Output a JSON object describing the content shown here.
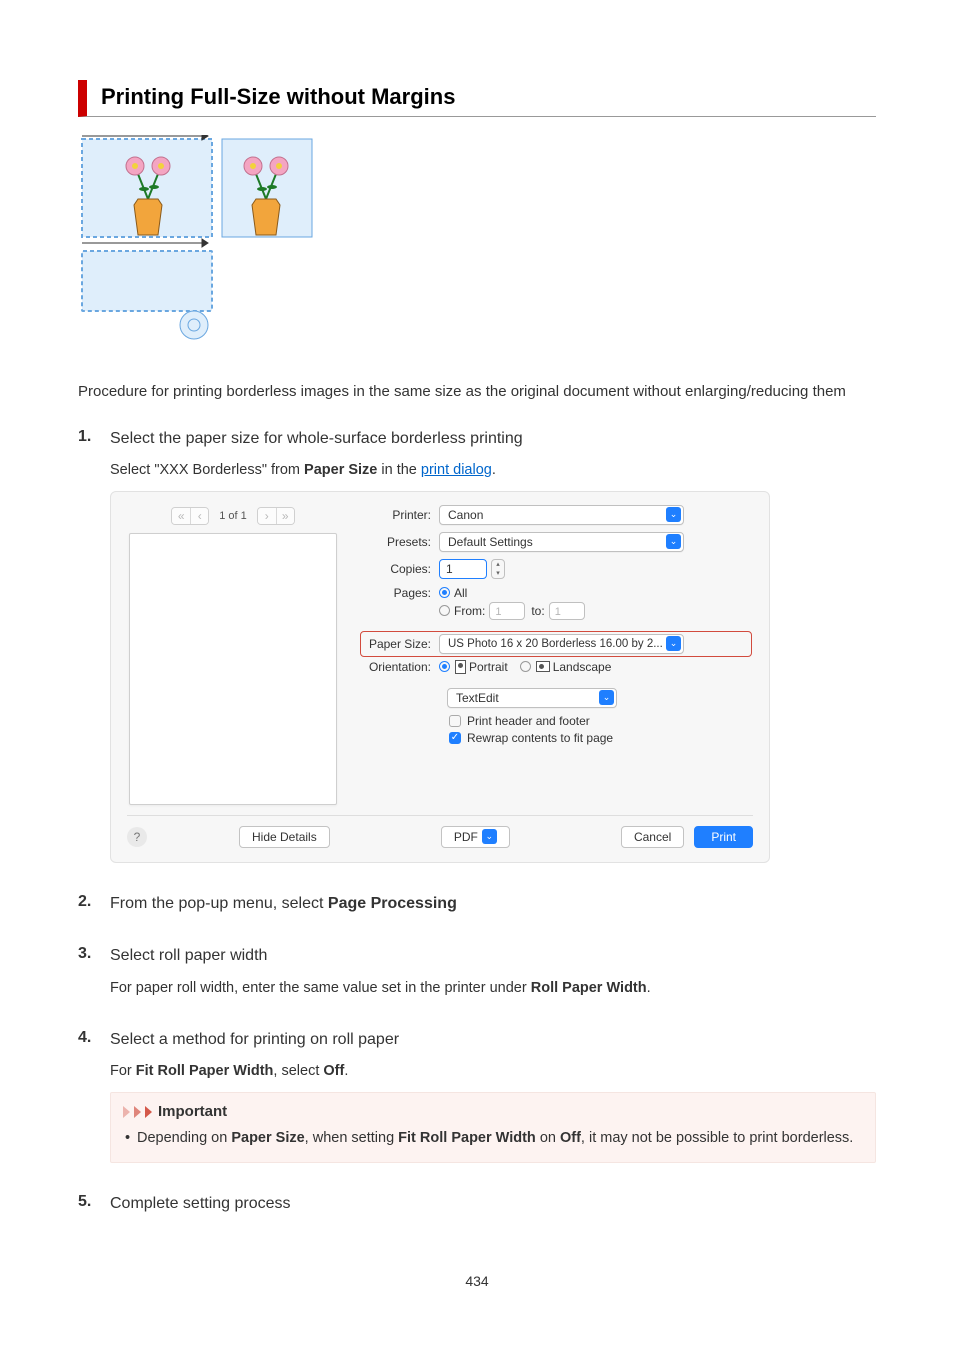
{
  "page_number": "434",
  "heading": "Printing Full-Size without Margins",
  "intro": "Procedure for printing borderless images in the same size as the original document without enlarging/reducing them",
  "steps": [
    {
      "title": "Select the paper size for whole-surface borderless printing",
      "body_prefix": "Select \"XXX Borderless\" from ",
      "body_bold1": "Paper Size",
      "body_mid": " in the ",
      "link_text": "print dialog",
      "body_suffix": "."
    },
    {
      "title_prefix": "From the pop-up menu, select ",
      "title_bold": "Page Processing"
    },
    {
      "title": "Select roll paper width",
      "body_prefix": "For paper roll width, enter the same value set in the printer under ",
      "body_bold1": "Roll Paper Width",
      "body_suffix": "."
    },
    {
      "title": "Select a method for printing on roll paper",
      "body_prefix": "For ",
      "body_bold1": "Fit Roll Paper Width",
      "body_mid": ", select ",
      "body_bold2": "Off",
      "body_suffix": ".",
      "important": {
        "label": "Important",
        "bullet_prefix": "Depending on ",
        "bullet_b1": "Paper Size",
        "bullet_mid1": ", when setting ",
        "bullet_b2": "Fit Roll Paper Width",
        "bullet_mid2": " on ",
        "bullet_b3": "Off",
        "bullet_suffix": ", it may not be possible to print borderless."
      }
    },
    {
      "title": "Complete setting process"
    }
  ],
  "dialog": {
    "page_indicator": "1 of 1",
    "nav_first": "«",
    "nav_prev": "‹",
    "nav_next": "›",
    "nav_last": "»",
    "labels": {
      "printer": "Printer:",
      "presets": "Presets:",
      "copies": "Copies:",
      "pages": "Pages:",
      "all": "All",
      "from": "From:",
      "to": "to:",
      "paper_size": "Paper Size:",
      "orientation": "Orientation:",
      "portrait": "Portrait",
      "landscape": "Landscape"
    },
    "values": {
      "printer": "Canon",
      "presets": "Default Settings",
      "copies": "1",
      "from": "1",
      "to": "1",
      "paper_size": "US Photo 16 x 20 Borderless 16.00 by 2...",
      "app_section": "TextEdit",
      "opt1": "Print header and footer",
      "opt2": "Rewrap contents to fit page"
    },
    "buttons": {
      "help": "?",
      "hide_details": "Hide Details",
      "pdf": "PDF",
      "cancel": "Cancel",
      "print": "Print"
    }
  }
}
